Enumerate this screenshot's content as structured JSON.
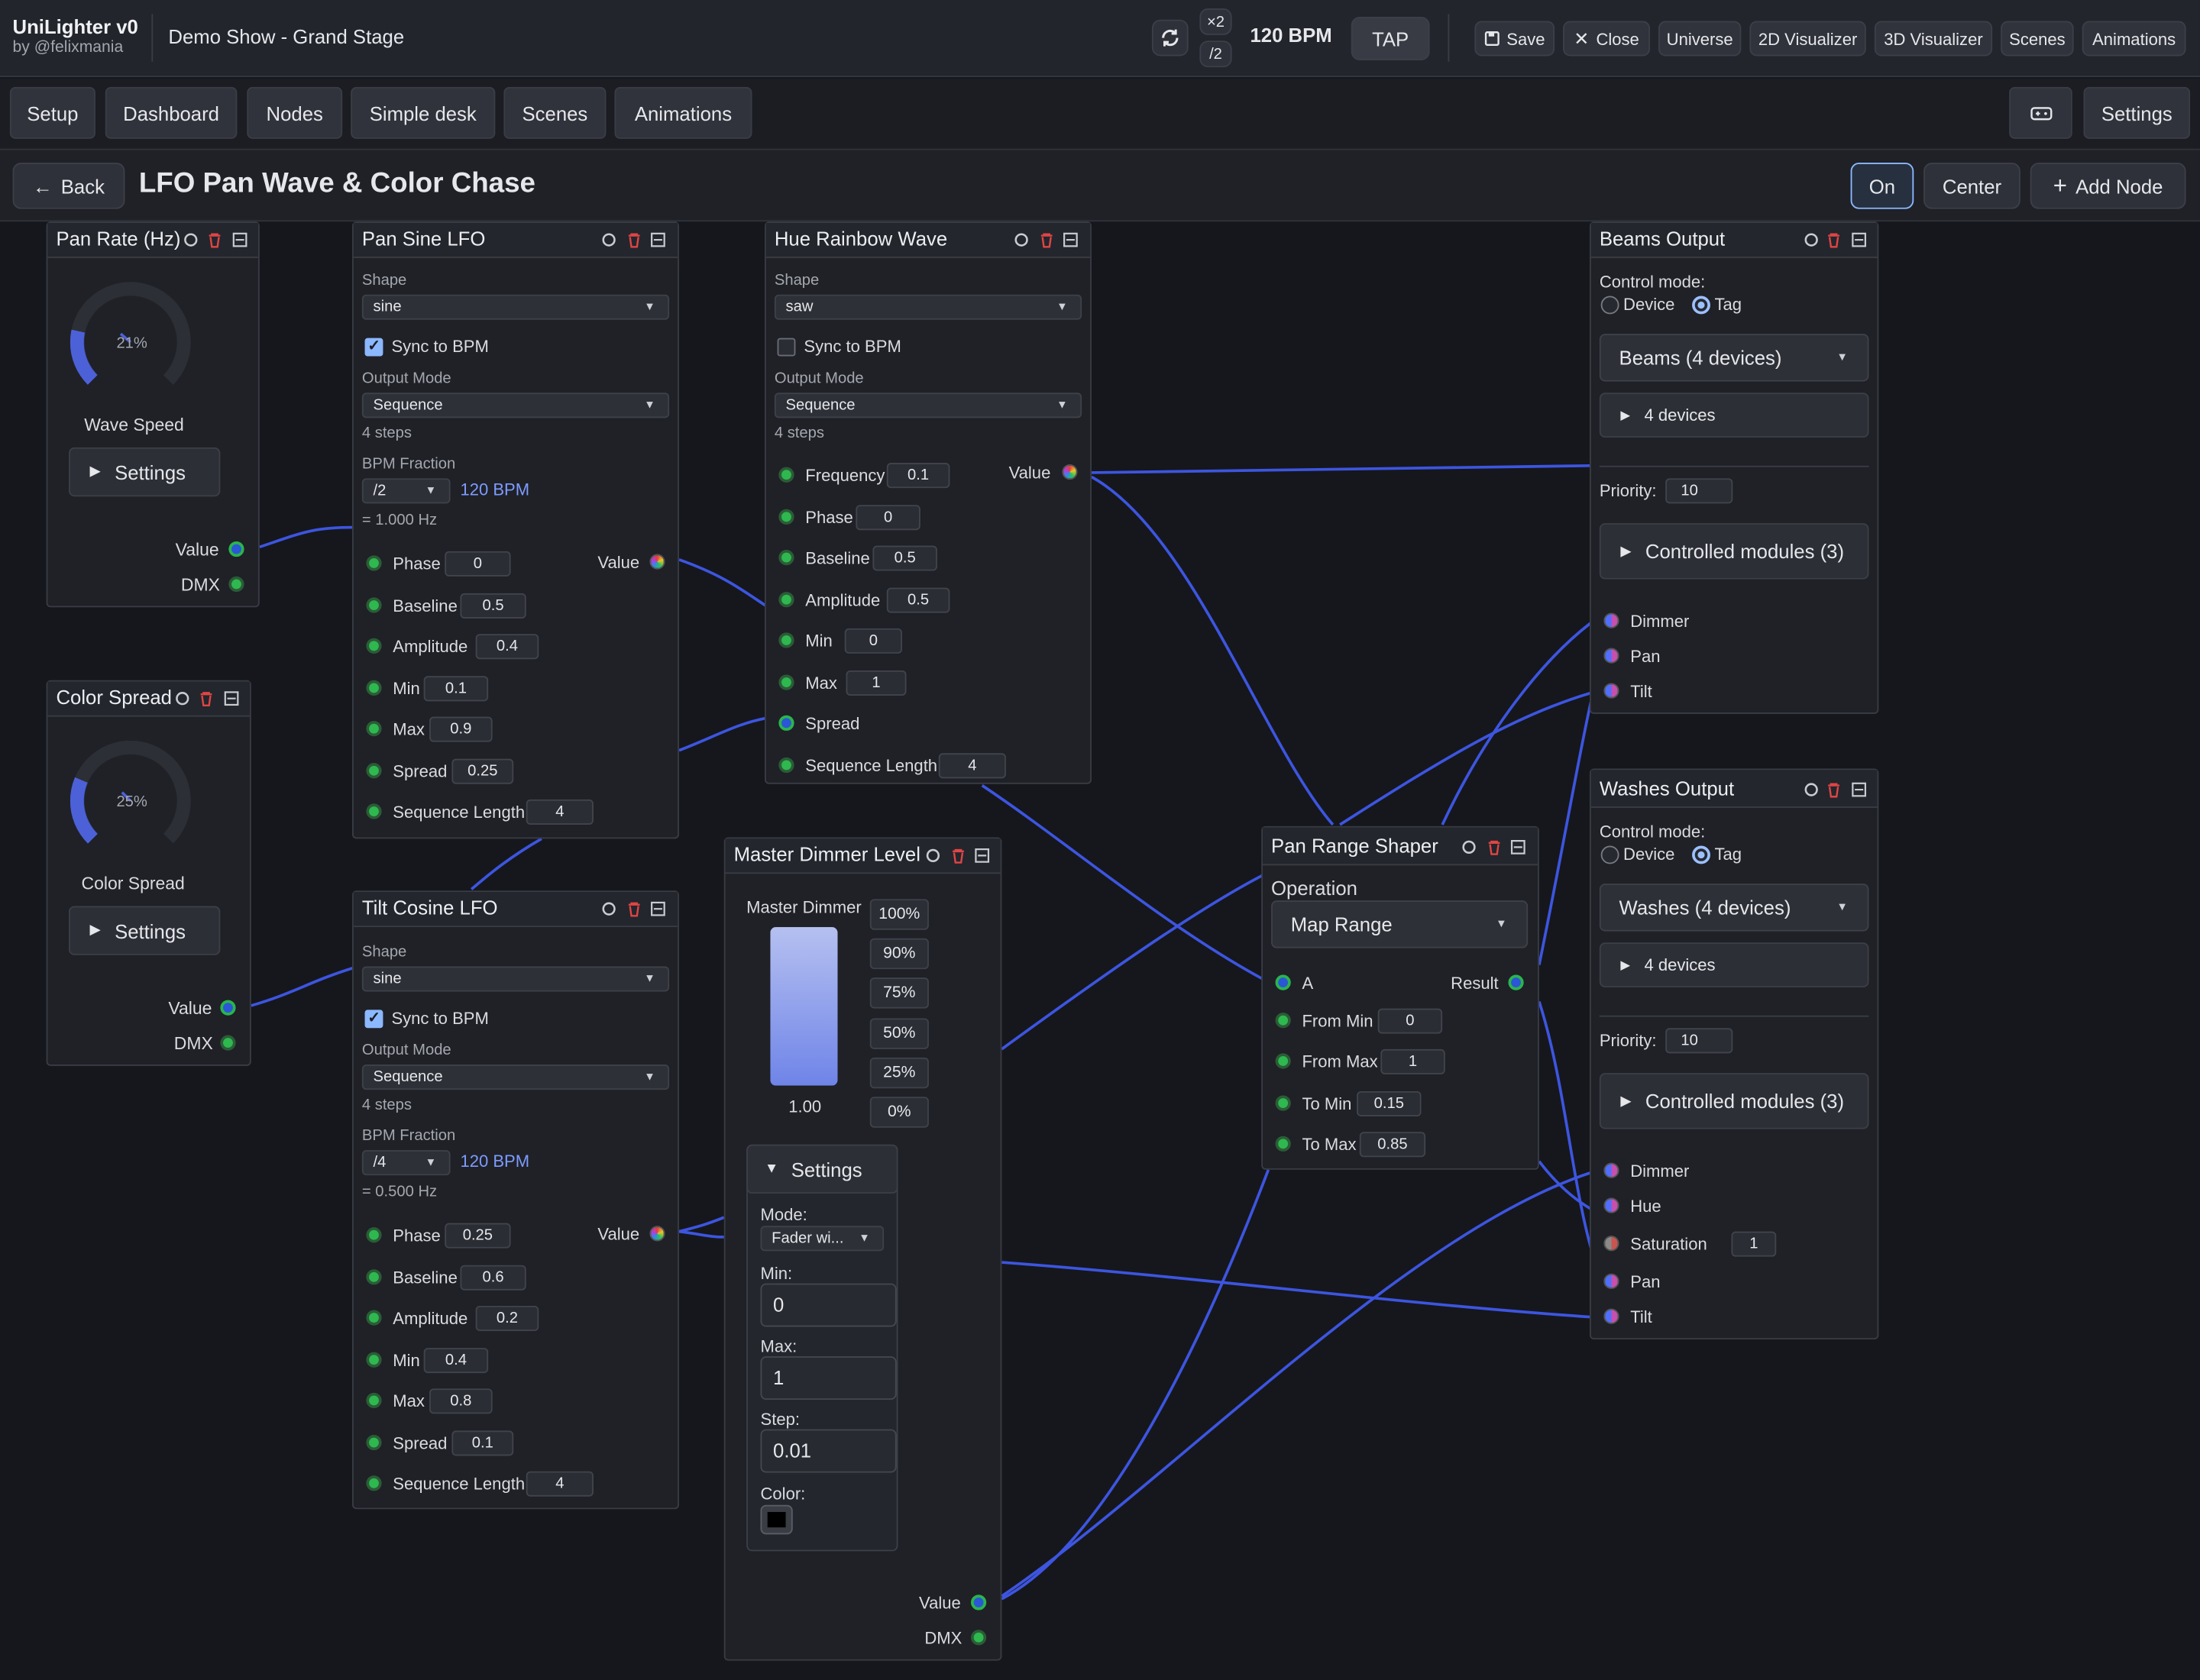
{
  "app": {
    "name": "UniLighter v0",
    "author": "by @felixmania",
    "show": "Demo Show - Grand Stage"
  },
  "transport": {
    "mult": "×2",
    "div": "/2",
    "bpm": "120 BPM",
    "tap": "TAP"
  },
  "toolbar": {
    "save": "Save",
    "close": "Close",
    "universe": "Universe",
    "viz2d": "2D Visualizer",
    "viz3d": "3D Visualizer",
    "scenes": "Scenes",
    "animations": "Animations"
  },
  "tabs": {
    "setup": "Setup",
    "dashboard": "Dashboard",
    "nodes": "Nodes",
    "simple": "Simple desk",
    "scenes": "Scenes",
    "animations": "Animations",
    "settings": "Settings"
  },
  "header": {
    "back": "Back",
    "title": "LFO Pan Wave & Color Chase",
    "on": "On",
    "center": "Center",
    "add": "Add Node"
  },
  "pan_rate": {
    "title": "Pan Rate (Hz)",
    "pct": "21%",
    "label": "Wave Speed",
    "settings": "Settings",
    "value": "Value",
    "dmx": "DMX",
    "level": 0.21
  },
  "color_spread": {
    "title": "Color Spread",
    "pct": "25%",
    "label": "Color Spread",
    "settings": "Settings",
    "value": "Value",
    "dmx": "DMX",
    "level": 0.25
  },
  "pan_lfo": {
    "title": "Pan Sine LFO",
    "shape_label": "Shape",
    "shape": "sine",
    "sync": "Sync to BPM",
    "mode_label": "Output Mode",
    "mode": "Sequence",
    "steps": "4 steps",
    "frac_label": "BPM Fraction",
    "frac": "/2",
    "bpm": "120 BPM",
    "hz": "= 1.000 Hz",
    "value": "Value",
    "params": [
      {
        "l": "Phase",
        "v": "0"
      },
      {
        "l": "Baseline",
        "v": "0.5"
      },
      {
        "l": "Amplitude",
        "v": "0.4"
      },
      {
        "l": "Min",
        "v": "0.1"
      },
      {
        "l": "Max",
        "v": "0.9"
      },
      {
        "l": "Spread",
        "v": "0.25"
      },
      {
        "l": "Sequence Length",
        "v": "4"
      }
    ]
  },
  "tilt_lfo": {
    "title": "Tilt Cosine LFO",
    "shape_label": "Shape",
    "shape": "sine",
    "sync": "Sync to BPM",
    "mode_label": "Output Mode",
    "mode": "Sequence",
    "steps": "4 steps",
    "frac_label": "BPM Fraction",
    "frac": "/4",
    "bpm": "120 BPM",
    "hz": "= 0.500 Hz",
    "value": "Value",
    "params": [
      {
        "l": "Phase",
        "v": "0.25"
      },
      {
        "l": "Baseline",
        "v": "0.6"
      },
      {
        "l": "Amplitude",
        "v": "0.2"
      },
      {
        "l": "Min",
        "v": "0.4"
      },
      {
        "l": "Max",
        "v": "0.8"
      },
      {
        "l": "Spread",
        "v": "0.1"
      },
      {
        "l": "Sequence Length",
        "v": "4"
      }
    ]
  },
  "hue": {
    "title": "Hue Rainbow Wave",
    "shape_label": "Shape",
    "shape": "saw",
    "sync": "Sync to BPM",
    "mode_label": "Output Mode",
    "mode": "Sequence",
    "steps": "4 steps",
    "value": "Value",
    "params": [
      {
        "l": "Frequency",
        "v": "0.1"
      },
      {
        "l": "Phase",
        "v": "0"
      },
      {
        "l": "Baseline",
        "v": "0.5"
      },
      {
        "l": "Amplitude",
        "v": "0.5"
      },
      {
        "l": "Min",
        "v": "0"
      },
      {
        "l": "Max",
        "v": "1"
      },
      {
        "l": "Spread",
        "v": ""
      },
      {
        "l": "Sequence Length",
        "v": "4"
      }
    ]
  },
  "dimmer": {
    "title": "Master Dimmer Level",
    "label": "Master Dimmer",
    "value_text": "1.00",
    "level": 1.0,
    "presets": [
      "100%",
      "90%",
      "75%",
      "50%",
      "25%",
      "0%"
    ],
    "settings": "Settings",
    "mode_label": "Mode:",
    "mode": "Fader wi...",
    "min_label": "Min:",
    "min": "0",
    "max_label": "Max:",
    "max": "1",
    "step_label": "Step:",
    "step": "0.01",
    "color_label": "Color:",
    "value": "Value",
    "dmx": "DMX"
  },
  "shaper": {
    "title": "Pan Range Shaper",
    "op_label": "Operation",
    "op": "Map Range",
    "a": "A",
    "result": "Result",
    "params": [
      {
        "l": "From Min",
        "v": "0"
      },
      {
        "l": "From Max",
        "v": "1"
      },
      {
        "l": "To Min",
        "v": "0.15"
      },
      {
        "l": "To Max",
        "v": "0.85"
      }
    ]
  },
  "beams": {
    "title": "Beams Output",
    "cm": "Control mode:",
    "device": "Device",
    "tag": "Tag",
    "group": "Beams (4 devices)",
    "devices": "4 devices",
    "prio_label": "Priority:",
    "prio": "10",
    "modules": "Controlled modules (3)",
    "ports": [
      "Dimmer",
      "Pan",
      "Tilt"
    ]
  },
  "washes": {
    "title": "Washes Output",
    "cm": "Control mode:",
    "device": "Device",
    "tag": "Tag",
    "group": "Washes (4 devices)",
    "devices": "4 devices",
    "prio_label": "Priority:",
    "prio": "10",
    "modules": "Controlled modules (3)",
    "ports": [
      "Dimmer",
      "Hue",
      "Saturation",
      "Pan",
      "Tilt"
    ],
    "sat": "1"
  },
  "colors": {
    "accent": "#8cb8ff",
    "wire": "#3d55e0",
    "port_green": "#2eb84f",
    "danger": "#e04545"
  }
}
